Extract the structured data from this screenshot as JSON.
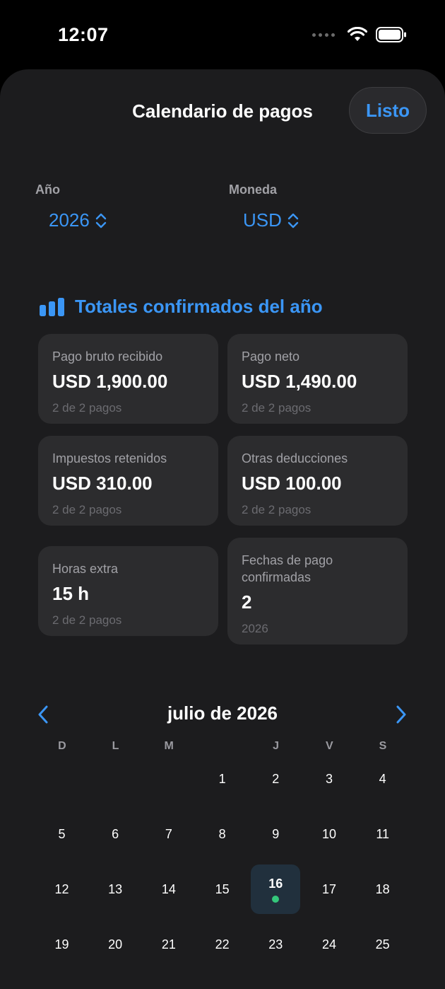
{
  "status": {
    "time": "12:07"
  },
  "sheet": {
    "title": "Calendario de pagos",
    "done_label": "Listo"
  },
  "pickers": {
    "year": {
      "label": "Año",
      "value": "2026"
    },
    "currency": {
      "label": "Moneda",
      "value": "USD"
    }
  },
  "section": {
    "title": "Totales confirmados del año",
    "icon": "chart-bar-icon"
  },
  "cards": [
    {
      "label": "Pago bruto recibido",
      "value": "USD 1,900.00",
      "sub": "2 de 2 pagos"
    },
    {
      "label": "Pago neto",
      "value": "USD 1,490.00",
      "sub": "2 de 2 pagos"
    },
    {
      "label": "Impuestos retenidos",
      "value": "USD 310.00",
      "sub": "2 de 2 pagos"
    },
    {
      "label": "Otras deducciones",
      "value": "USD 100.00",
      "sub": "2 de 2 pagos"
    },
    {
      "label": "Horas extra",
      "value": "15 h",
      "sub": "2 de 2 pagos"
    },
    {
      "label": "Fechas de pago confirmadas",
      "value": "2",
      "sub": "2026"
    }
  ],
  "calendar": {
    "month_label": "julio de 2026",
    "weekdays": [
      "D",
      "L",
      "M",
      "",
      "J",
      "V",
      "S"
    ],
    "first_weekday_index": 3,
    "visible_days": 25,
    "selected_day": 16,
    "days_with_payment": [
      16
    ]
  },
  "colors": {
    "accent": "#3b96f5",
    "payment_dot": "#34c77b",
    "background": "#1c1c1e"
  }
}
